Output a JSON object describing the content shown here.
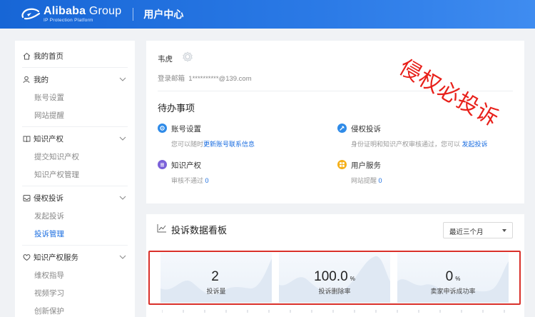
{
  "header": {
    "brand_bold": "Alibaba",
    "brand_light": " Group",
    "brand_sub": "IP Protection Platform",
    "title": "用户中心"
  },
  "sidebar": {
    "home": "我的首页",
    "groups": [
      {
        "label": "我的",
        "icon": "user-icon",
        "items": [
          "账号设置",
          "网站提醒"
        ]
      },
      {
        "label": "知识产权",
        "icon": "book-icon",
        "items": [
          "提交知识产权",
          "知识产权管理"
        ]
      },
      {
        "label": "侵权投诉",
        "icon": "inbox-icon",
        "items": [
          "发起投诉",
          "投诉管理"
        ]
      },
      {
        "label": "知识产权服务",
        "icon": "heart-icon",
        "items": [
          "维权指导",
          "视频学习",
          "创新保护"
        ]
      }
    ],
    "active_item": "投诉管理"
  },
  "user": {
    "name": "韦虎",
    "email_label": "登录邮箱",
    "email_value": "1**********@139.com"
  },
  "todo": {
    "title": "待办事项",
    "items": [
      {
        "title": "账号设置",
        "desc": "您可以随时",
        "link": "更新账号联系信息",
        "suffix": "",
        "color": "#2f8be8",
        "icon": "gear-icon"
      },
      {
        "title": "侵权投诉",
        "desc": "身份证明和知识产权审核通过，您可以",
        "link": "发起投诉",
        "suffix": "",
        "color": "#2f8be8",
        "icon": "complaint-icon"
      },
      {
        "title": "知识产权",
        "desc": "审核不通过",
        "link": "0",
        "suffix": "",
        "color": "#7b61d9",
        "icon": "ip-icon"
      },
      {
        "title": "用户服务",
        "desc": "网站提醒",
        "link": "0",
        "suffix": "",
        "color": "#f5b01a",
        "icon": "service-icon"
      }
    ]
  },
  "watermark": "侵权必投诉",
  "stats": {
    "title": "投诉数据看板",
    "period": "最近三个月",
    "tiles": [
      {
        "value": "2",
        "unit": "",
        "label": "投诉量"
      },
      {
        "value": "100.0",
        "unit": "%",
        "label": "投诉删除率"
      },
      {
        "value": "0",
        "unit": "%",
        "label": "卖家申诉成功率"
      }
    ]
  },
  "colors": {
    "header_blue": "#1766d6",
    "link_blue": "#1a6de0",
    "highlight_red": "#d9302a"
  }
}
